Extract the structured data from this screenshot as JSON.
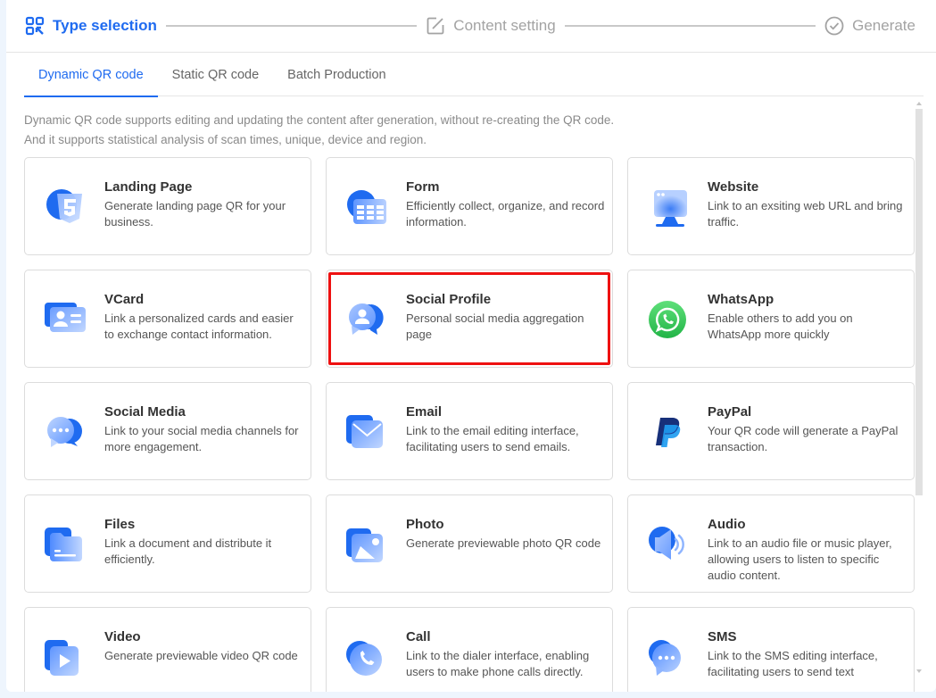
{
  "steps": [
    {
      "label": "Type selection",
      "icon": "qr-scan-icon",
      "state": "active"
    },
    {
      "label": "Content setting",
      "icon": "edit-icon",
      "state": "pending"
    },
    {
      "label": "Generate",
      "icon": "check-circle-icon",
      "state": "pending"
    }
  ],
  "tabs": [
    {
      "label": "Dynamic QR code",
      "active": true
    },
    {
      "label": "Static QR code",
      "active": false
    },
    {
      "label": "Batch Production",
      "active": false
    }
  ],
  "description": {
    "line1": "Dynamic QR code supports editing and updating the content after generation, without re-creating the QR code.",
    "line2": "And it supports statistical analysis of scan times, unique, device and region."
  },
  "colors": {
    "accent": "#1f6bf0",
    "highlight": "#ee1111"
  },
  "cards": [
    {
      "title": "Landing Page",
      "text": "Generate landing page QR for your business.",
      "icon": "html5-icon"
    },
    {
      "title": "Form",
      "text": "Efficiently collect, organize, and record information.",
      "icon": "form-table-icon"
    },
    {
      "title": "Website",
      "text": "Link to an exsiting web URL and bring traffic.",
      "icon": "monitor-icon"
    },
    {
      "title": "VCard",
      "text": "Link a personalized cards and easier to exchange contact information.",
      "icon": "contact-card-icon"
    },
    {
      "title": "Social Profile",
      "text": "Personal social media aggregation page",
      "icon": "profile-chat-icon",
      "highlighted": true
    },
    {
      "title": "WhatsApp",
      "text": "Enable others to add you on WhatsApp more quickly",
      "icon": "whatsapp-icon"
    },
    {
      "title": "Social Media",
      "text": "Link to your social media channels for more engagement.",
      "icon": "chat-bubbles-icon"
    },
    {
      "title": "Email",
      "text": "Link to the email editing interface, facilitating users to send emails.",
      "icon": "envelope-icon"
    },
    {
      "title": "PayPal",
      "text": "Your QR code will generate a PayPal transaction.",
      "icon": "paypal-icon"
    },
    {
      "title": "Files",
      "text": "Link a document and distribute it efficiently.",
      "icon": "folder-icon"
    },
    {
      "title": "Photo",
      "text": "Generate previewable photo QR code",
      "icon": "image-icon"
    },
    {
      "title": "Audio",
      "text": "Link to an audio file or music player, allowing users to listen to specific audio content.",
      "icon": "speaker-icon"
    },
    {
      "title": "Video",
      "text": "Generate previewable video QR code",
      "icon": "play-icon"
    },
    {
      "title": "Call",
      "text": "Link to the dialer interface, enabling users to make phone calls directly.",
      "icon": "phone-icon"
    },
    {
      "title": "SMS",
      "text": "Link to the SMS editing interface, facilitating users to send text",
      "icon": "sms-bubble-icon"
    }
  ]
}
